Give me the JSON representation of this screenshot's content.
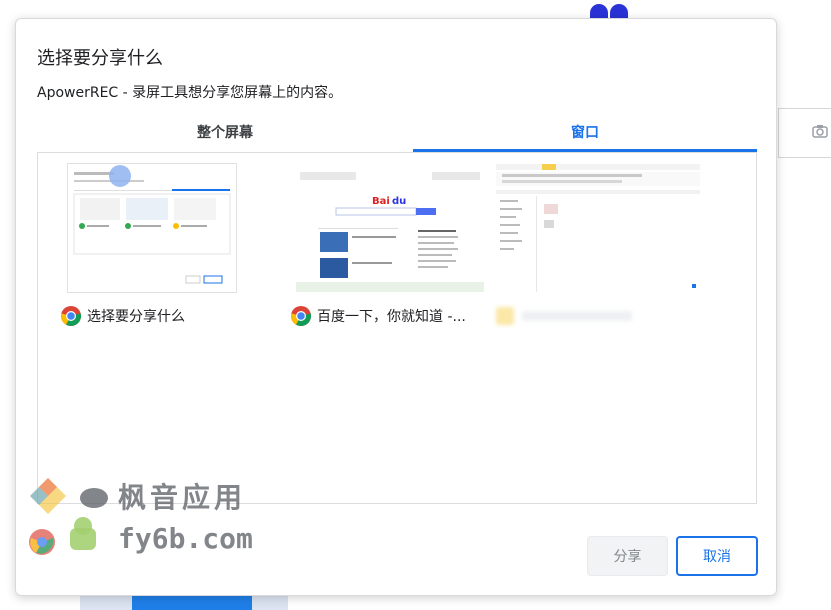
{
  "dialog": {
    "title": "选择要分享什么",
    "description": "ApowerREC - 录屏工具想分享您屏幕上的内容。",
    "tabs": [
      {
        "label": "整个屏幕",
        "selected": false
      },
      {
        "label": "窗口",
        "selected": true
      }
    ],
    "windows": [
      {
        "label": "选择要分享什么",
        "icon": "chrome-icon"
      },
      {
        "label": "百度一下，你就知道 -...",
        "icon": "chrome-icon"
      },
      {
        "label": "",
        "icon": "blurred-app-icon"
      }
    ],
    "share_button": "分享",
    "cancel_button": "取消"
  },
  "watermark": {
    "line1": "枫音应用",
    "line2": "fy6b.com"
  },
  "colors": {
    "accent": "#1a73e8",
    "disabled_button_bg": "#f1f3f4",
    "text": "#202124"
  }
}
